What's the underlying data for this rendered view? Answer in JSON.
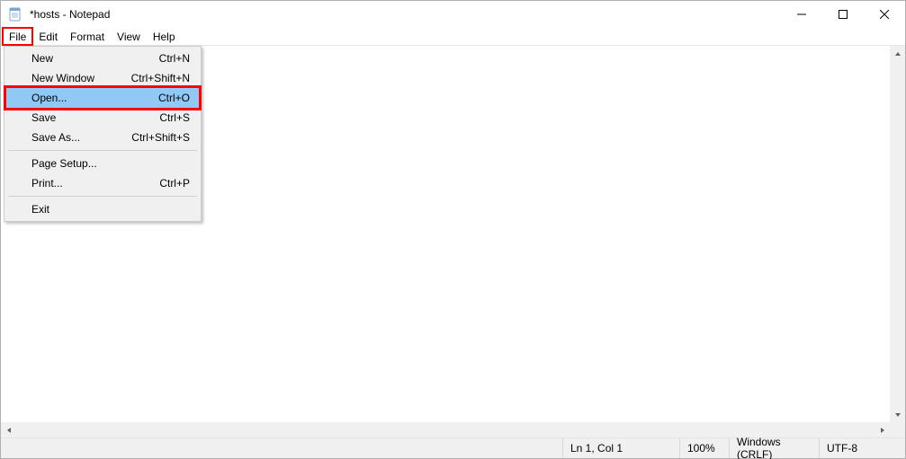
{
  "title": "*hosts - Notepad",
  "menubar": {
    "file": "File",
    "edit": "Edit",
    "format": "Format",
    "view": "View",
    "help": "Help"
  },
  "file_menu": {
    "new": {
      "label": "New",
      "shortcut": "Ctrl+N"
    },
    "new_window": {
      "label": "New Window",
      "shortcut": "Ctrl+Shift+N"
    },
    "open": {
      "label": "Open...",
      "shortcut": "Ctrl+O"
    },
    "save": {
      "label": "Save",
      "shortcut": "Ctrl+S"
    },
    "save_as": {
      "label": "Save As...",
      "shortcut": "Ctrl+Shift+S"
    },
    "page_setup": {
      "label": "Page Setup...",
      "shortcut": ""
    },
    "print": {
      "label": "Print...",
      "shortcut": "Ctrl+P"
    },
    "exit": {
      "label": "Exit",
      "shortcut": ""
    }
  },
  "status": {
    "position": "Ln 1, Col 1",
    "zoom": "100%",
    "line_ending": "Windows (CRLF)",
    "encoding": "UTF-8"
  }
}
